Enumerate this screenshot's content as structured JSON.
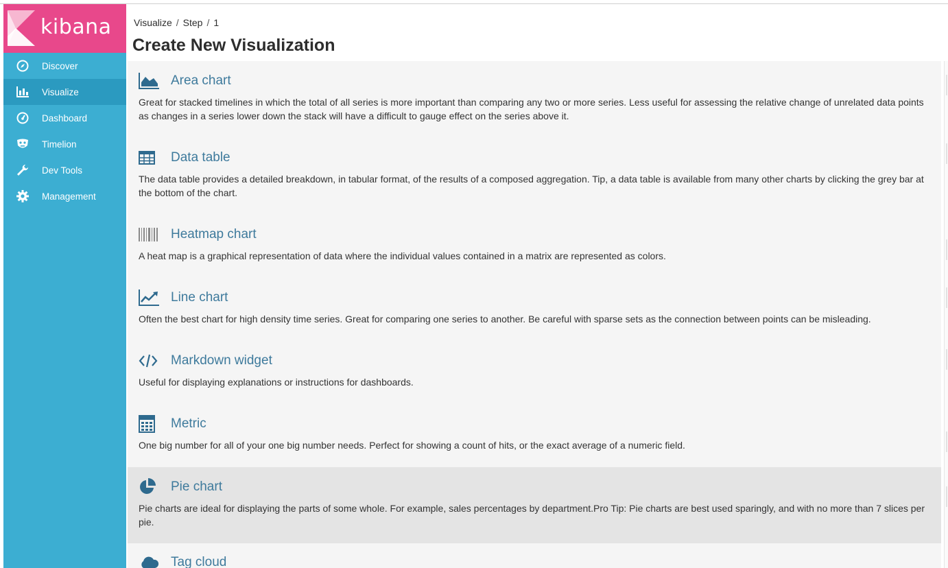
{
  "app": {
    "name": "kibana"
  },
  "sidebar": {
    "items": [
      {
        "label": "Discover",
        "icon": "compass-icon",
        "active": false
      },
      {
        "label": "Visualize",
        "icon": "bar-chart-icon",
        "active": true
      },
      {
        "label": "Dashboard",
        "icon": "dashboard-gauge-icon",
        "active": false
      },
      {
        "label": "Timelion",
        "icon": "timelion-mask-icon",
        "active": false
      },
      {
        "label": "Dev Tools",
        "icon": "wrench-icon",
        "active": false
      },
      {
        "label": "Management",
        "icon": "gear-icon",
        "active": false
      }
    ]
  },
  "breadcrumb": {
    "part1": "Visualize",
    "part2": "Step",
    "part3": "1",
    "separator": "/"
  },
  "page": {
    "title": "Create New Visualization"
  },
  "visualizations": [
    {
      "title": "Area chart",
      "icon": "area-chart-icon",
      "description": "Great for stacked timelines in which the total of all series is more important than comparing any two or more series. Less useful for assessing the relative change of unrelated data points as changes in a series lower down the stack will have a difficult to gauge effect on the series above it."
    },
    {
      "title": "Data table",
      "icon": "table-icon",
      "description": "The data table provides a detailed breakdown, in tabular format, of the results of a composed aggregation. Tip, a data table is available from many other charts by clicking the grey bar at the bottom of the chart."
    },
    {
      "title": "Heatmap chart",
      "icon": "barcode-icon",
      "description": "A heat map is a graphical representation of data where the individual values contained in a matrix are represented as colors."
    },
    {
      "title": "Line chart",
      "icon": "line-chart-icon",
      "description": "Often the best chart for high density time series. Great for comparing one series to another. Be careful with sparse sets as the connection between points can be misleading."
    },
    {
      "title": "Markdown widget",
      "icon": "code-icon",
      "description": "Useful for displaying explanations or instructions for dashboards."
    },
    {
      "title": "Metric",
      "icon": "calculator-icon",
      "description": "One big number for all of your one big number needs. Perfect for showing a count of hits, or the exact average of a numeric field."
    },
    {
      "title": "Pie chart",
      "icon": "pie-chart-icon",
      "description": "Pie charts are ideal for displaying the parts of some whole. For example, sales percentages by department.Pro Tip: Pie charts are best used sparingly, and with no more than 7 slices per pie.",
      "hovered": true
    },
    {
      "title": "Tag cloud",
      "icon": "cloud-icon",
      "description": ""
    }
  ],
  "colors": {
    "sidebar": "#3caed2",
    "sidebar_active": "#2b9ac0",
    "logo_bg": "#e8488b",
    "link": "#3e7a9c",
    "icon": "#2e6a8e",
    "list_bg": "#f5f5f5",
    "hover_bg": "#e4e4e4"
  }
}
